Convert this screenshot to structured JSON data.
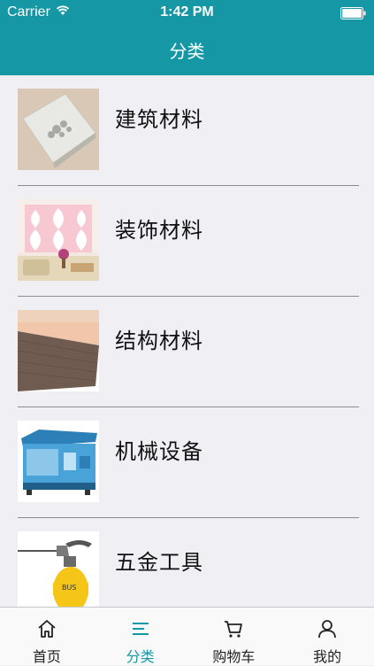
{
  "status_bar": {
    "carrier": "Carrier",
    "time": "1:42 PM"
  },
  "nav": {
    "title": "分类"
  },
  "categories": [
    {
      "label": "建筑材料"
    },
    {
      "label": "装饰材料"
    },
    {
      "label": "结构材料"
    },
    {
      "label": "机械设备"
    },
    {
      "label": "五金工具"
    }
  ],
  "tabbar": {
    "items": [
      {
        "label": "首页",
        "icon": "home-icon"
      },
      {
        "label": "分类",
        "icon": "category-icon",
        "active": true
      },
      {
        "label": "购物车",
        "icon": "cart-icon"
      },
      {
        "label": "我的",
        "icon": "user-icon"
      }
    ]
  },
  "colors": {
    "accent": "#1697a6",
    "background": "#efeff4"
  }
}
